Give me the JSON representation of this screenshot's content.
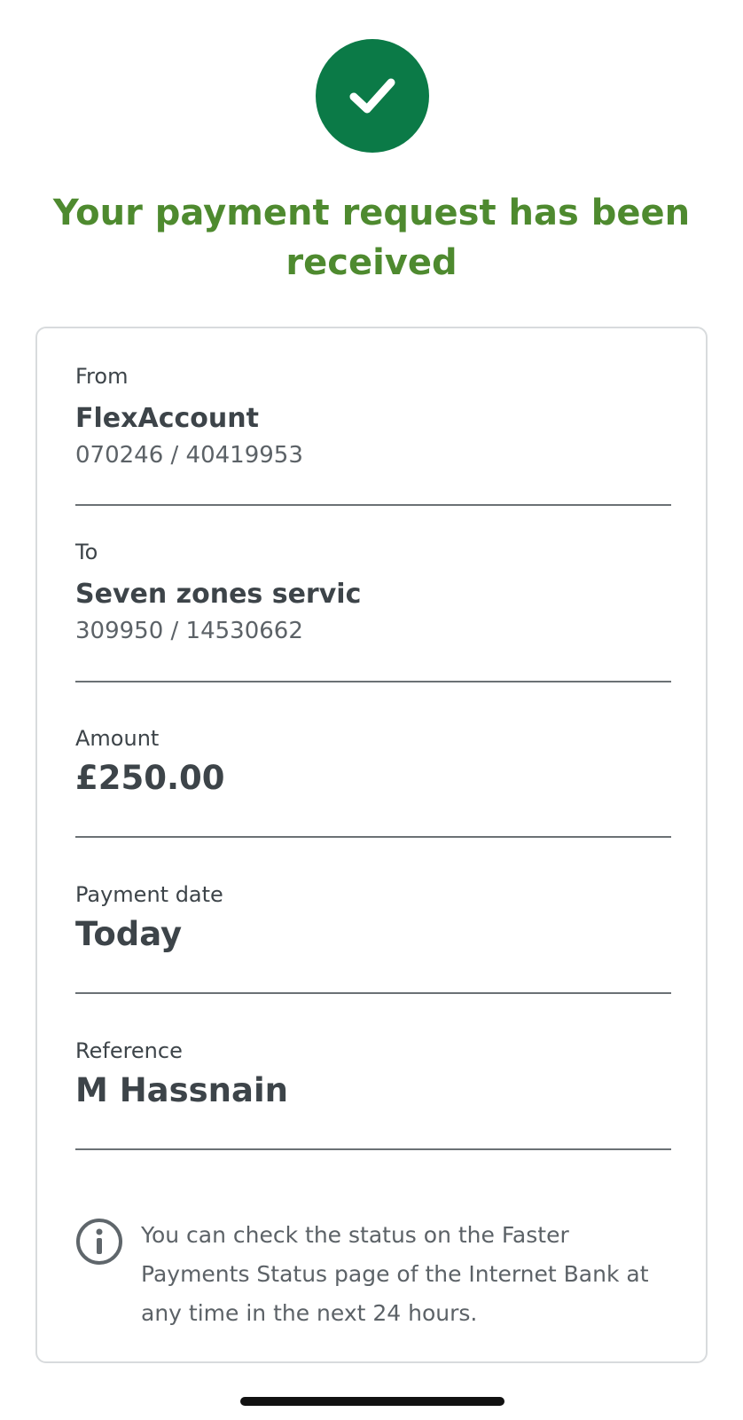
{
  "colors": {
    "success_green": "#0b7a47",
    "headline_green": "#4e8a2f",
    "text_dark": "#3d4449",
    "text_muted": "#5c6267"
  },
  "status": {
    "icon": "checkmark-icon",
    "headline": "Your payment request has been received"
  },
  "details": {
    "from": {
      "label": "From",
      "account_name": "FlexAccount",
      "account_numbers": "070246 / 40419953"
    },
    "to": {
      "label": "To",
      "payee_name": "Seven zones servic",
      "account_numbers": "309950 / 14530662"
    },
    "amount": {
      "label": "Amount",
      "value": "£250.00"
    },
    "payment_date": {
      "label": "Payment date",
      "value": "Today"
    },
    "reference": {
      "label": "Reference",
      "value": "M Hassnain"
    }
  },
  "info": {
    "icon": "info-icon",
    "text": "You can check the status on the Faster Payments Status page of the Internet Bank at any time in the next 24 hours."
  }
}
